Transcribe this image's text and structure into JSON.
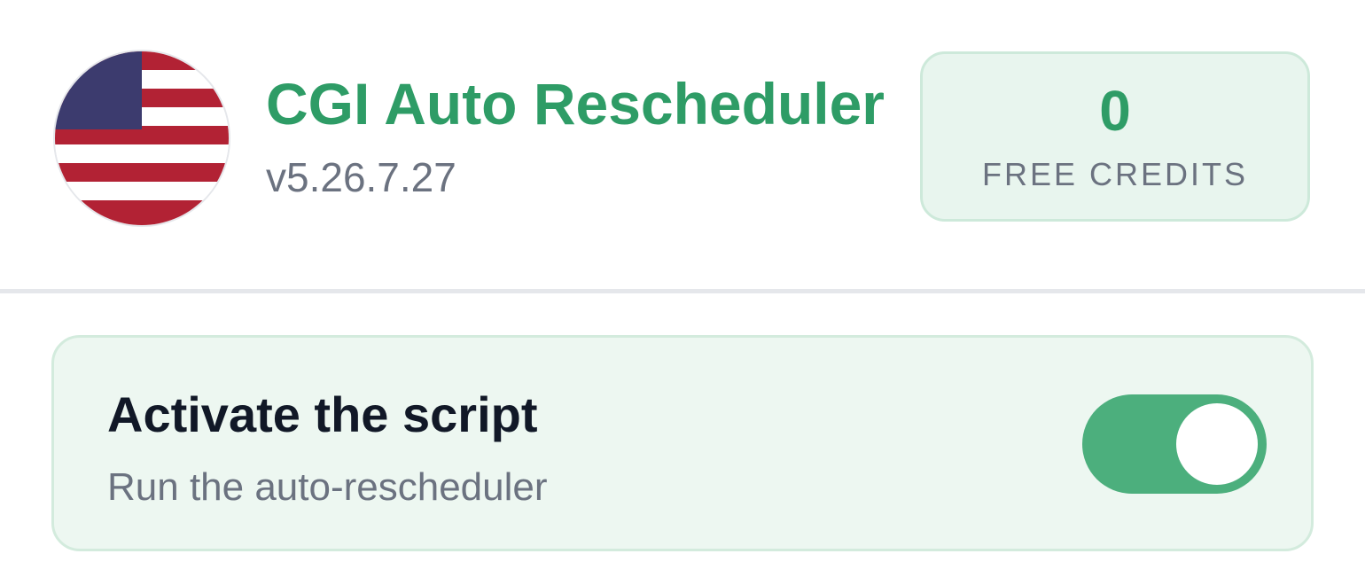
{
  "header": {
    "flag_icon": "us-flag-icon",
    "title": "CGI Auto Rescheduler",
    "version": "v5.26.7.27",
    "credits": {
      "value": "0",
      "label": "FREE CREDITS"
    }
  },
  "activation": {
    "title": "Activate the script",
    "subtitle": "Run the auto-rescheduler",
    "toggle_on": true
  },
  "colors": {
    "brand_green": "#2e9c66",
    "toggle_green": "#4caf7d",
    "card_background": "#edf7f1",
    "flag_blue": "#3c3b6e",
    "flag_red": "#b22234"
  }
}
